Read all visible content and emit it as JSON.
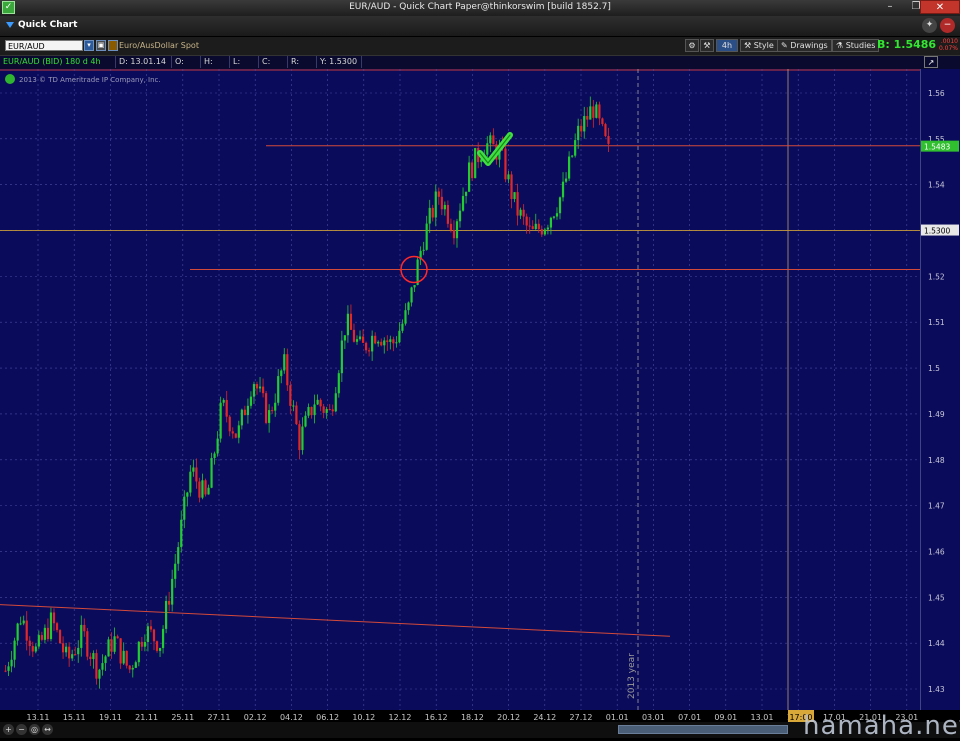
{
  "window": {
    "title": "EUR/AUD - Quick Chart Paper@thinkorswim [build 1852.7]",
    "close_label": "✕",
    "max_label": "❐",
    "min_label": "–"
  },
  "panel": {
    "title": "Quick Chart"
  },
  "toolbar": {
    "symbol": "EUR/AUD",
    "description": "Euro/AusDollar Spot",
    "aggregation": "4h",
    "style_label": "Style",
    "drawings_label": "Drawings",
    "studies_label": "Studies",
    "bid_label": "B: 1.5486",
    "change_top": ".0010",
    "change_bottom": "0.07%"
  },
  "info": {
    "symbol_bar": "EUR/AUD (BID) 180 d 4h",
    "date": "D: 13.01.14 17:00",
    "open": "O: N/A",
    "high": "H: N/A",
    "low": "L: N/A",
    "close": "C: N/A",
    "range": "R: N/A",
    "y": "Y: 1.5300"
  },
  "copyright": "2013 © TD Ameritrade IP Company, Inc.",
  "colors": {
    "chart_bg": "#0b0b5c",
    "up": "#22cc33",
    "down": "#e02828",
    "level": "#d24a3a",
    "grid": "#4a4aa0"
  },
  "chart_data": {
    "type": "candlestick",
    "ylim": [
      1.425,
      1.5655
    ],
    "y_ticks": [
      1.43,
      1.44,
      1.45,
      1.46,
      1.47,
      1.48,
      1.49,
      1.5,
      1.51,
      1.52,
      1.53,
      1.54,
      1.55,
      1.56
    ],
    "y_tick_labels": [
      "1.43",
      "1.44",
      "1.45",
      "1.46",
      "1.47",
      "1.48",
      "1.49",
      "1.5",
      "1.51",
      "1.52",
      "1.53",
      "1.54",
      "1.55",
      "1.56"
    ],
    "x_labels": [
      "13.11",
      "15.11",
      "19.11",
      "21.11",
      "25.11",
      "27.11",
      "02.12",
      "04.12",
      "06.12",
      "10.12",
      "12.12",
      "16.12",
      "18.12",
      "20.12",
      "24.12",
      "27.12",
      "01.01",
      "03.01",
      "07.01",
      "09.01",
      "13.01",
      "15.01",
      "17.01",
      "21.01",
      "23.01"
    ],
    "x_label_count": 25,
    "year_marker": "2013 year",
    "cursor_time_label": "17:00",
    "current_price_label": "1.5483",
    "cursor_price_label": "1.5300",
    "current_price": 1.5483,
    "cursor_price": 1.53,
    "support_level": 1.5215,
    "resistance_level": 1.5485,
    "trendline_start": 1.4484,
    "trendline_end": 1.4415,
    "path": [
      1.434,
      1.446,
      1.438,
      1.445,
      1.436,
      1.442,
      1.434,
      1.441,
      1.434,
      1.443,
      1.44,
      1.458,
      1.478,
      1.471,
      1.492,
      1.485,
      1.498,
      1.489,
      1.501,
      1.484,
      1.493,
      1.49,
      1.51,
      1.504,
      1.508,
      1.505,
      1.512,
      1.528,
      1.538,
      1.531,
      1.543,
      1.549,
      1.547,
      1.535,
      1.529,
      1.532,
      1.538,
      1.551,
      1.557,
      1.547
    ]
  }
}
